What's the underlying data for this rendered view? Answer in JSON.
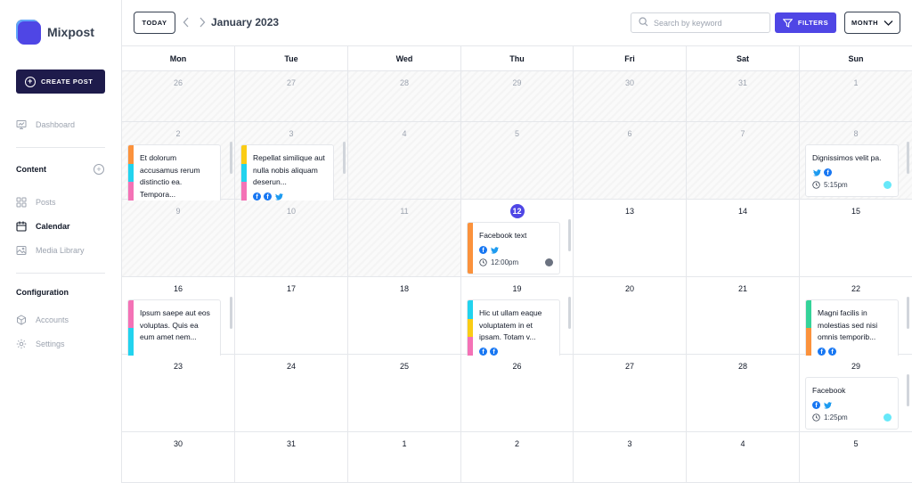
{
  "app": {
    "name": "Mixpost"
  },
  "sidebar": {
    "create_label": "CREATE POST",
    "dashboard": "Dashboard",
    "content_title": "Content",
    "posts": "Posts",
    "calendar": "Calendar",
    "media": "Media Library",
    "config_title": "Configuration",
    "accounts": "Accounts",
    "settings": "Settings"
  },
  "toolbar": {
    "today_label": "TODAY",
    "month_title": "January 2023",
    "search_placeholder": "Search by keyword",
    "filters_label": "FILTERS",
    "view_label": "MONTH"
  },
  "colors": {
    "accent": "#4f46e5",
    "sidebar_button": "#1e1b4b",
    "facebook": "#1877f2",
    "twitter": "#1d9bf0",
    "orange": "#fb923c",
    "cyan": "#22d3ee",
    "pink": "#f472b6",
    "yellow": "#facc15",
    "green": "#34d399"
  },
  "calendar": {
    "weekdays": [
      "Mon",
      "Tue",
      "Wed",
      "Thu",
      "Fri",
      "Sat",
      "Sun"
    ],
    "today": "12",
    "weeks": [
      [
        "26",
        "27",
        "28",
        "29",
        "30",
        "31",
        "1"
      ],
      [
        "2",
        "3",
        "4",
        "5",
        "6",
        "7",
        "8"
      ],
      [
        "9",
        "10",
        "11",
        "12",
        "13",
        "14",
        "15"
      ],
      [
        "16",
        "17",
        "18",
        "19",
        "20",
        "21",
        "22"
      ],
      [
        "23",
        "24",
        "25",
        "26",
        "27",
        "28",
        "29"
      ],
      [
        "30",
        "31",
        "1",
        "2",
        "3",
        "4",
        "5"
      ]
    ],
    "posts": [
      {
        "week": 1,
        "day": 0,
        "text": "Et dolorum accusamus rerum distinctio ea. Tempora...",
        "stripes": [
          "orange",
          "cyan",
          "pink"
        ],
        "icons": [],
        "time": "",
        "status": "",
        "cut": true
      },
      {
        "week": 1,
        "day": 1,
        "text": "Repellat similique aut nulla nobis aliquam deserun...",
        "stripes": [
          "yellow",
          "cyan",
          "pink"
        ],
        "icons": [
          "facebook-icon",
          "facebook-icon",
          "twitter-icon"
        ],
        "time": "",
        "status": "",
        "cut": true
      },
      {
        "week": 1,
        "day": 6,
        "text": "Dignissimos velit pa.",
        "stripes": [],
        "icons": [
          "twitter-icon",
          "facebook-icon"
        ],
        "time": "5:15pm",
        "status": "#67e8f9",
        "cut": false
      },
      {
        "week": 2,
        "day": 3,
        "text": "Facebook text",
        "stripes": [
          "orange"
        ],
        "icons": [
          "facebook-icon",
          "twitter-icon"
        ],
        "time": "12:00pm",
        "status": "#6b7280",
        "cut": false
      },
      {
        "week": 3,
        "day": 0,
        "text": "Ipsum saepe aut eos voluptas. Quis ea eum amet nem...",
        "stripes": [
          "pink",
          "cyan"
        ],
        "icons": [],
        "time": "",
        "status": "",
        "cut": true
      },
      {
        "week": 3,
        "day": 3,
        "text": "Hic ut ullam eaque voluptatem in et ipsam. Totam v...",
        "stripes": [
          "cyan",
          "yellow",
          "pink"
        ],
        "icons": [
          "facebook-icon",
          "facebook-icon"
        ],
        "time": "",
        "status": "",
        "cut": true
      },
      {
        "week": 3,
        "day": 6,
        "text": "Magni facilis in molestias sed nisi omnis temporib...",
        "stripes": [
          "green",
          "orange"
        ],
        "icons": [
          "facebook-icon",
          "facebook-icon"
        ],
        "time": "",
        "status": "",
        "cut": true
      },
      {
        "week": 4,
        "day": 6,
        "text": "Facebook",
        "stripes": [],
        "icons": [
          "facebook-icon",
          "twitter-icon"
        ],
        "time": "1:25pm",
        "status": "#67e8f9",
        "cut": false
      }
    ]
  }
}
